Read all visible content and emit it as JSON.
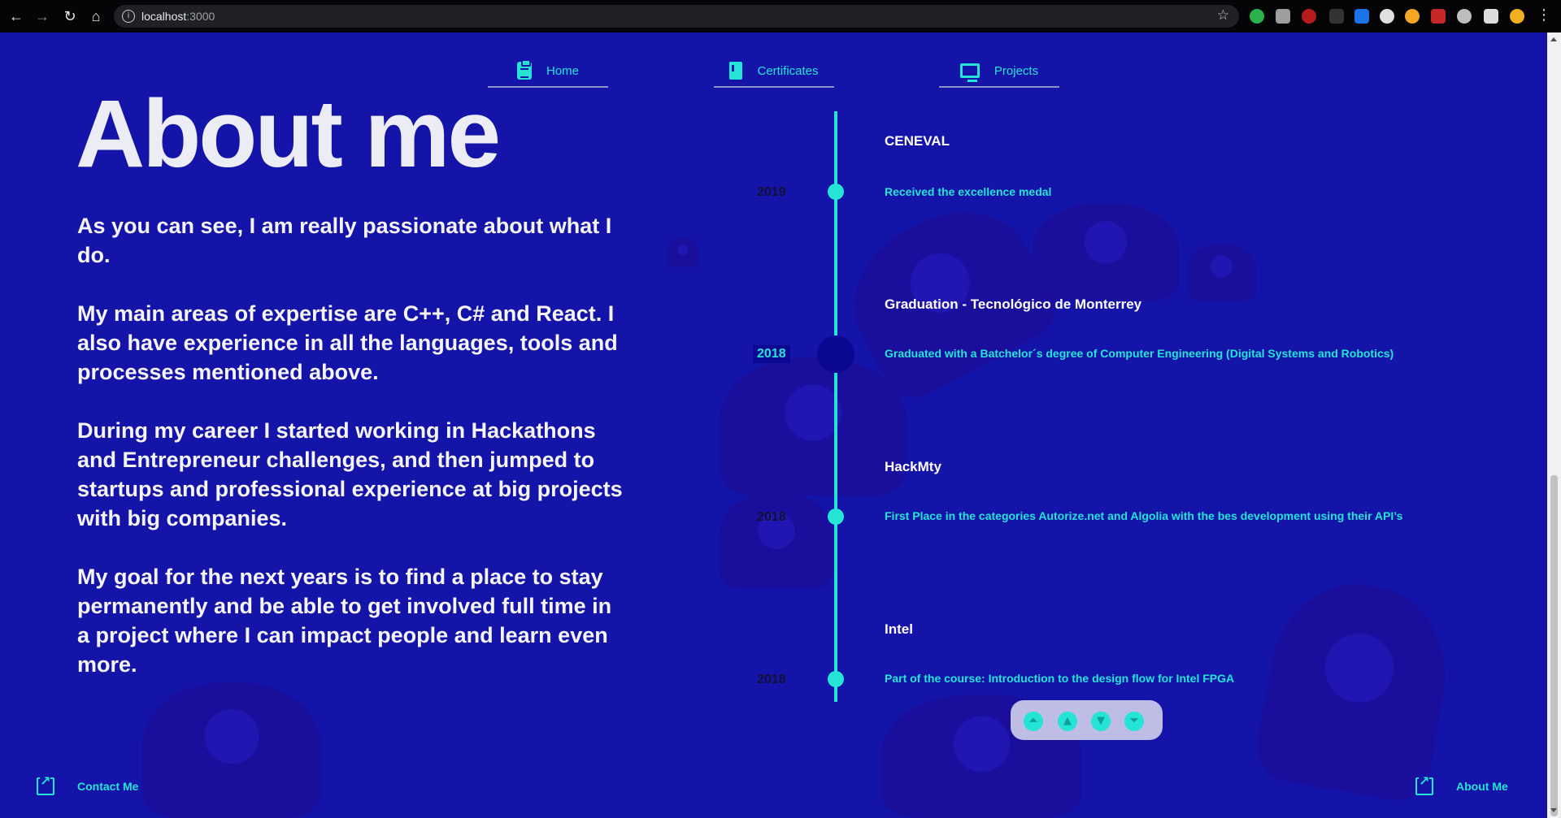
{
  "browser": {
    "url_host": "localhost",
    "url_port": ":3000"
  },
  "nav": {
    "home": "Home",
    "certificates": "Certificates",
    "projects": "Projects"
  },
  "about": {
    "title": "About me",
    "paragraphs": [
      "As you can see, I am really passionate about what I do.",
      "My main areas of expertise are C++, C# and React. I also have experience in all the languages, tools and processes mentioned above.",
      "During my career I started working in Hackathons and Entrepreneur challenges, and then jumped to startups and professional experience at big projects with big companies.",
      "My goal for the next years is to find a place to stay permanently and be able to get involved full time in a project where I can impact people and learn even more."
    ]
  },
  "timeline": [
    {
      "year": "2019",
      "title": "CENEVAL",
      "description": "Received the excellence medal"
    },
    {
      "year": "2018",
      "title": "Graduation - Tecnológico de Monterrey",
      "description": "Graduated with a Batchelor´s degree of Computer Engineering (Digital Systems and Robotics)"
    },
    {
      "year": "2018",
      "title": "HackMty",
      "description": "First Place in the categories Autorize.net and Algolia with the bes development using their API’s"
    },
    {
      "year": "2018",
      "title": "Intel",
      "description": "Part of the course: Introduction to the design flow for Intel FPGA"
    }
  ],
  "footer": {
    "contact": "Contact Me",
    "about": "About Me"
  },
  "colors": {
    "background": "#1514a8",
    "accent": "#25e4d6"
  }
}
